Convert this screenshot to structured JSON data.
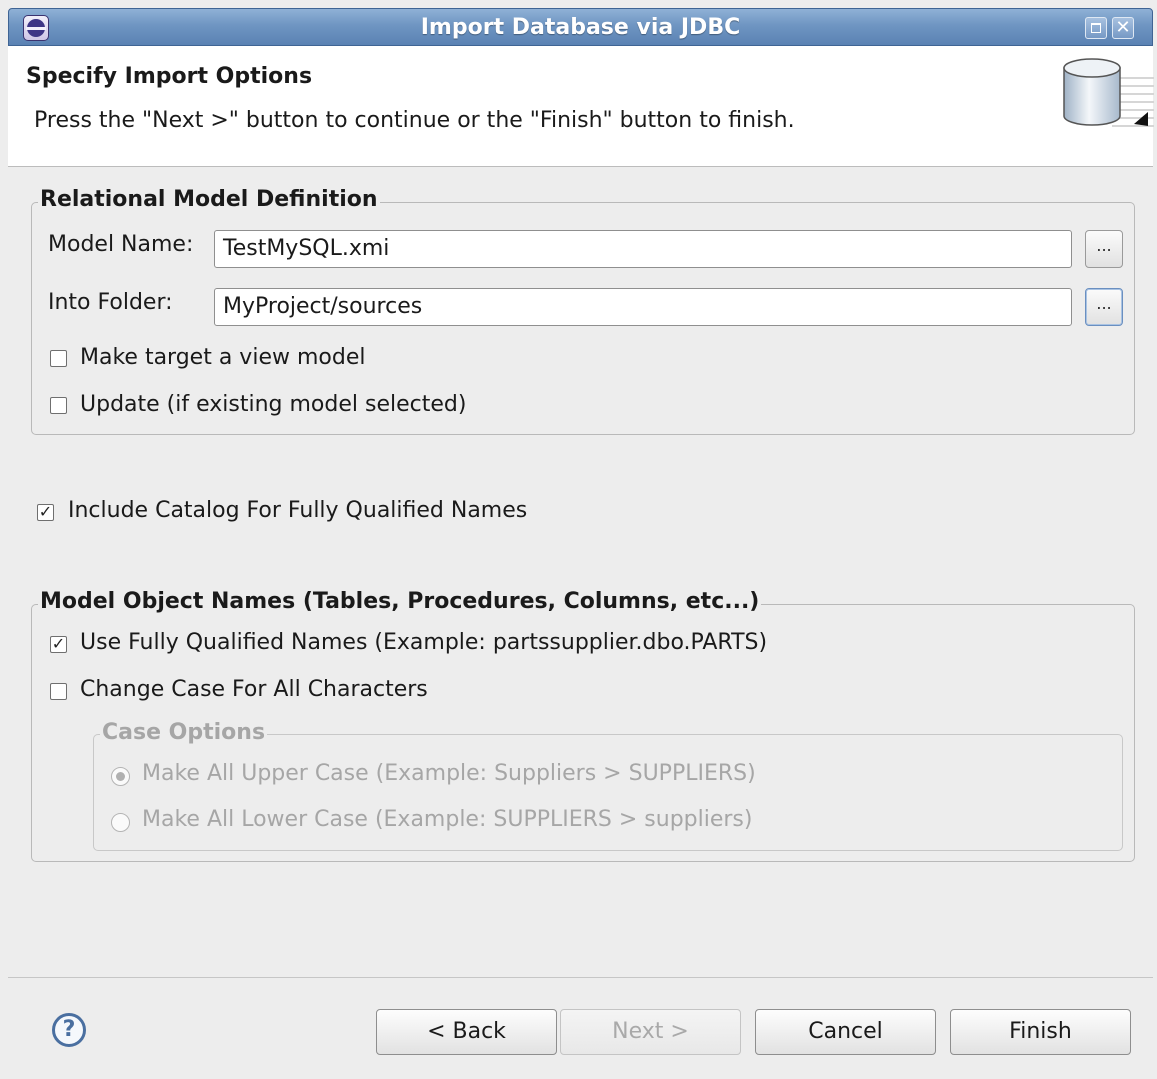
{
  "window": {
    "title": "Import Database via JDBC",
    "close_glyph": "✕"
  },
  "header": {
    "title": "Specify Import Options",
    "description": "Press the \"Next >\" button to continue or the \"Finish\" button to finish.",
    "icon": "database-icon"
  },
  "relational_model": {
    "legend": "Relational Model Definition",
    "model_name_label": "Model Name:",
    "model_name_value": "TestMySQL.xmi",
    "into_folder_label": "Into Folder:",
    "into_folder_value": "MyProject/sources",
    "browse_label": "...",
    "view_model_label": "Make target a view model",
    "view_model_checked": false,
    "update_label": "Update (if existing model selected)",
    "update_checked": false
  },
  "include_catalog": {
    "label": "Include Catalog For Fully Qualified Names",
    "checked": true
  },
  "object_names": {
    "legend": "Model Object Names (Tables, Procedures, Columns, etc...)",
    "fully_qualified_label": "Use Fully Qualified Names  (Example: partssupplier.dbo.PARTS)",
    "fully_qualified_checked": true,
    "change_case_label": "Change Case For All Characters",
    "change_case_checked": false,
    "case_options": {
      "legend": "Case Options",
      "upper_label": "Make All Upper Case  (Example: Suppliers > SUPPLIERS)",
      "upper_selected": true,
      "lower_label": "Make All Lower Case  (Example: SUPPLIERS > suppliers)",
      "lower_selected": false,
      "enabled": false
    }
  },
  "footer": {
    "help_glyph": "?",
    "back_label": "< Back",
    "next_label": "Next >",
    "cancel_label": "Cancel",
    "finish_label": "Finish",
    "check_glyph": "✓"
  },
  "colors": {
    "titlebar": "#6f95c2",
    "background": "#ededed",
    "disabled_text": "#a6a6a6"
  }
}
